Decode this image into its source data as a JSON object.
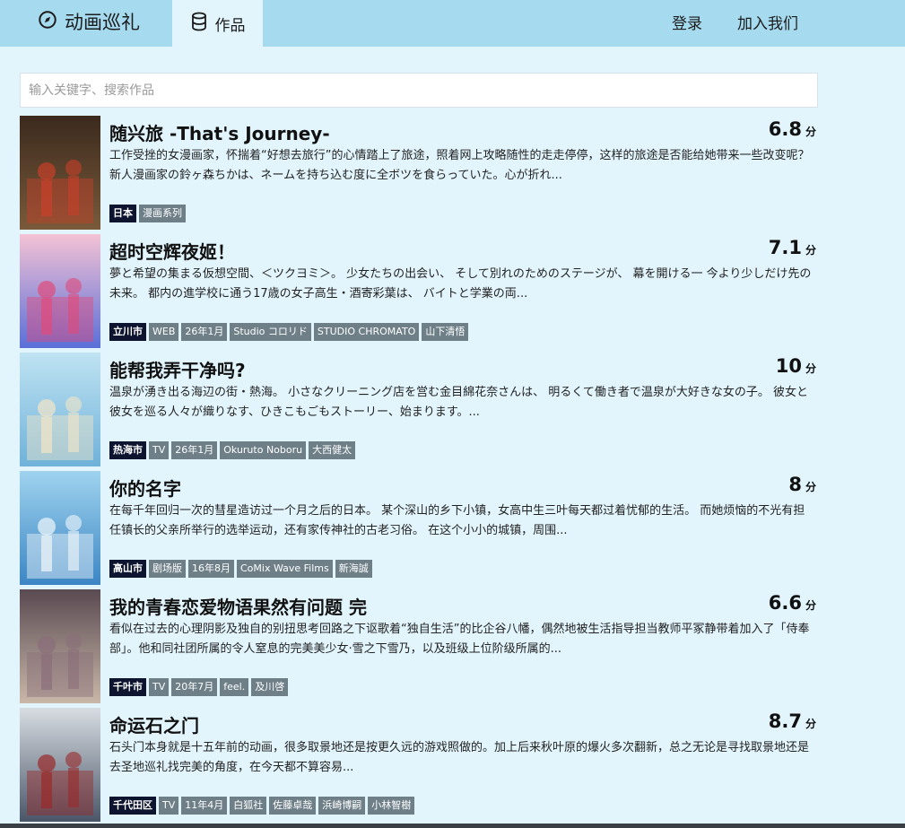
{
  "nav": {
    "brand": "动画巡礼",
    "works": "作品",
    "login": "登录",
    "join": "加入我们"
  },
  "search": {
    "placeholder": "输入关键字、搜索作品",
    "value": ""
  },
  "score_unit": "分",
  "items": [
    {
      "title": "随兴旅 -That's Journey-",
      "score": "6.8",
      "desc": "工作受挫的女漫画家，怀揣着“好想去旅行”的心情踏上了旅途，照着网上攻略随性的走走停停，这样的旅途是否能给她带来一些改变呢？ 新人漫画家の鈴ヶ森ちかは、ネームを持ち込む度に全ボツを食らっていた。心が折れ...",
      "tags": [
        "日本",
        "漫画系列"
      ],
      "poster_colors": [
        "#3b2a1e",
        "#7a5a3a",
        "#c8402a"
      ]
    },
    {
      "title": "超时空辉夜姬！",
      "score": "7.1",
      "desc": "夢と希望の集まる仮想空間、＜ツクヨミ＞。 少女たちの出会い、 そして別れのためのステージが、 幕を開ける一 今より少しだけ先の未来。 都内の進学校に通う17歳の女子高生・酒寄彩葉は、 バイトと学業の両...",
      "tags": [
        "立川市",
        "WEB",
        "26年1月",
        "Studio コロリド",
        "STUDIO CHROMATO",
        "山下清悟"
      ],
      "poster_colors": [
        "#f4c2d4",
        "#5a6fd8",
        "#e04a7a"
      ]
    },
    {
      "title": "能帮我弄干净吗?",
      "score": "10",
      "desc": "温泉が湧き出る海辺の街・熱海。 小さなクリーニング店を営む金目綿花奈さんは、 明るくて働き者で温泉が大好きな女の子。 彼女と彼女を巡る人々が織りなす、ひきこもごもストーリー、始まります。...",
      "tags": [
        "热海市",
        "TV",
        "26年1月",
        "Okuruto Noboru",
        "大西健太"
      ],
      "poster_colors": [
        "#bfe3f2",
        "#6fb1d9",
        "#f2e6c8"
      ]
    },
    {
      "title": "你的名字",
      "score": "8",
      "desc": "在每千年回归一次的彗星造访过一个月之后的日本。 某个深山的乡下小镇，女高中生三叶每天都过着忧郁的生活。 而她烦恼的不光有担任镇长的父亲所举行的选举运动，还有家传神社的古老习俗。 在这个小小的城镇，周围...",
      "tags": [
        "高山市",
        "剧场版",
        "16年8月",
        "CoMix Wave Films",
        "新海誠"
      ],
      "poster_colors": [
        "#9fd3ef",
        "#3c86c4",
        "#f0f6fa"
      ]
    },
    {
      "title": "我的青春恋爱物语果然有问题 完",
      "score": "6.6",
      "desc": "看似在过去的心理阴影及独自的别扭思考回路之下讴歌着“独自生活”的比企谷八幡，偶然地被生活指导担当教师平冢静带着加入了「侍奉部」。他和同社团所属的令人窒息的完美美少女·雪之下雪乃，以及班级上位阶级所属的...",
      "tags": [
        "千叶市",
        "TV",
        "20年7月",
        "feel.",
        "及川啓"
      ],
      "poster_colors": [
        "#5a4a52",
        "#c9b8a8",
        "#8a6e7a"
      ]
    },
    {
      "title": "命运石之门",
      "score": "8.7",
      "desc": "石头门本身就是十五年前的动画，很多取景地还是按更久远的游戏照做的。加上后来秋叶原的爆火多次翻新，总之无论是寻找取景地还是去圣地巡礼找完美的角度，在今天都不算容易...",
      "tags": [
        "千代田区",
        "TV",
        "11年4月",
        "白狐社",
        "佐藤卓哉",
        "浜崎博嗣",
        "小林智樹"
      ],
      "poster_colors": [
        "#d8dde2",
        "#4a5668",
        "#9a2a2a"
      ]
    }
  ]
}
